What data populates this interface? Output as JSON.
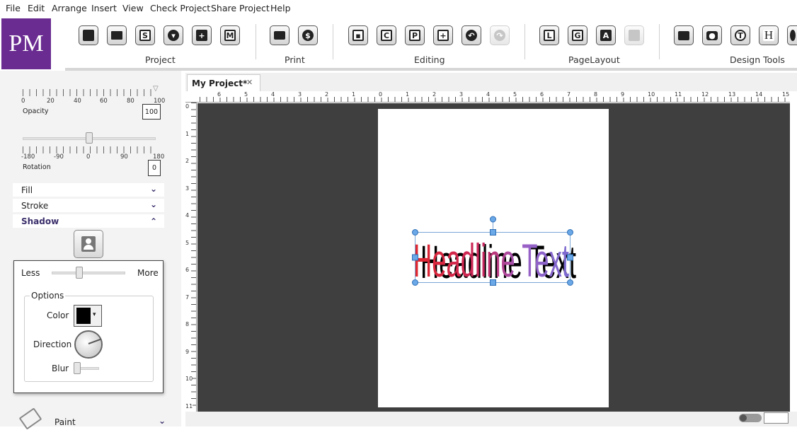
{
  "menu": [
    "File",
    "Edit",
    "Arrange",
    "Insert",
    "View",
    "Check Project",
    "Share Project",
    "Help"
  ],
  "logo": "PM",
  "ribbon": {
    "groups": [
      "Project",
      "Print",
      "Editing",
      "PageLayout",
      "Design Tools"
    ]
  },
  "left_panel": {
    "opacity": {
      "label": "Opacity",
      "value": "100",
      "scale": [
        "0",
        "20",
        "40",
        "60",
        "80",
        "100"
      ]
    },
    "rotation": {
      "label": "Rotation",
      "value": "0",
      "scale": [
        "-180",
        "-90",
        "0",
        "90",
        "180"
      ]
    },
    "sections": [
      "Fill",
      "Stroke",
      "Shadow"
    ],
    "paint_label": "Paint"
  },
  "shadow_popup": {
    "less": "Less",
    "more": "More",
    "options_label": "Options",
    "color_label": "Color",
    "direction_label": "Direction",
    "blur_label": "Blur"
  },
  "document": {
    "tab_title": "My Project*",
    "close_glyph": "✕",
    "headline": "Headline Text",
    "hruler": [
      "6",
      "5",
      "4",
      "3",
      "2",
      "1",
      "0",
      "1",
      "2",
      "3",
      "4",
      "5",
      "6",
      "7",
      "8",
      "9",
      "10",
      "11",
      "12",
      "13",
      "14",
      "15"
    ],
    "vruler": [
      "0",
      "1",
      "2",
      "3",
      "4",
      "5",
      "6",
      "7",
      "8",
      "9",
      "10",
      "11"
    ]
  },
  "icons": {
    "toolbar": [
      "new-document-icon",
      "open-folder-icon",
      "save-icon",
      "download-icon",
      "add-page-icon",
      "template-icon",
      "printer-icon",
      "share-icon",
      "crop-icon",
      "clipart-c-icon",
      "paragraph-p-icon",
      "align-plus-icon",
      "undo-icon",
      "redo-icon",
      "layout-l-icon",
      "guides-g-icon",
      "text-a-icon",
      "disabled-shape-icon",
      "image-icon",
      "camera-icon",
      "text-t-icon",
      "headline-h-icon",
      "gear-icon"
    ]
  },
  "colors": {
    "brand": "#6a2c91",
    "canvas": "#3f3f3f",
    "section_active": "#3b2f6b",
    "selection": "#4a90d9"
  }
}
